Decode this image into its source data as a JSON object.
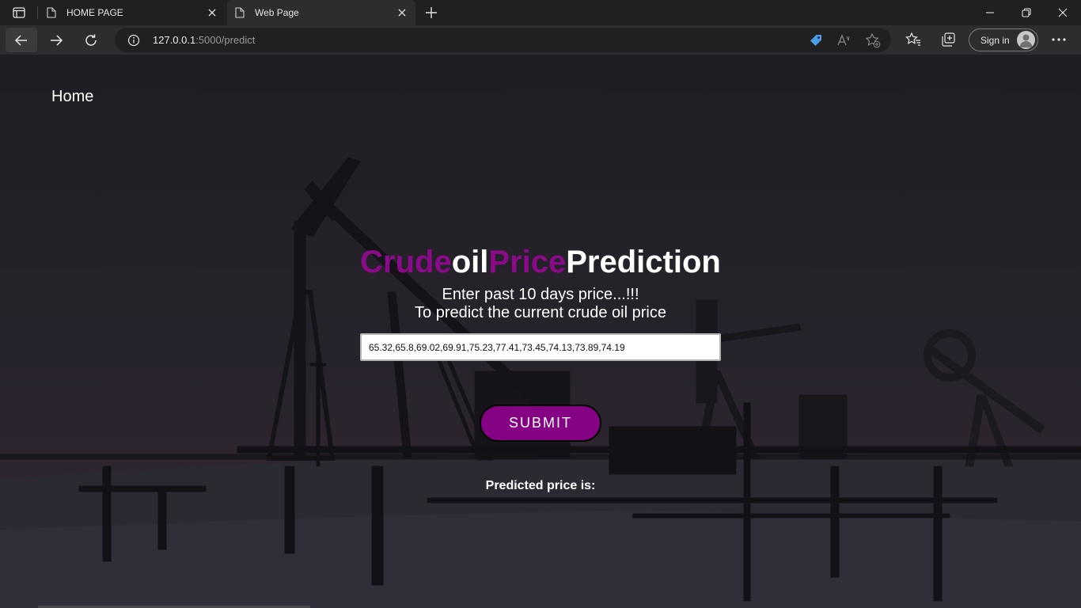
{
  "browser": {
    "tabs": [
      {
        "label": "HOME PAGE",
        "active": false
      },
      {
        "label": "Web Page",
        "active": true
      }
    ],
    "url_host": "127.0.0.1",
    "url_rest": ":5000/predict",
    "signin_label": "Sign in",
    "icons": {
      "tab_actions": "tab-actions-icon",
      "page": "page-icon",
      "close": "close-icon",
      "new_tab": "plus-icon",
      "back": "arrow-left-icon",
      "forward": "arrow-right-icon",
      "reload": "reload-icon",
      "info": "info-icon",
      "coupon": "tag-icon",
      "read_aloud": "read-aloud-icon",
      "add_favorite": "star-plus-icon",
      "favorites": "favorites-icon",
      "collections": "collections-icon",
      "more": "more-icon"
    }
  },
  "page": {
    "nav_home": "Home",
    "heading_parts": [
      "Crude",
      "oil",
      "Price",
      "Prediction"
    ],
    "subtitle_line1": "Enter past 10 days price...!!!",
    "subtitle_line2": "To predict the current crude oil price",
    "input_value": "65.32,65.8,69.02,69.91,75.23,77.41,73.45,74.13,73.89,74.19",
    "submit_label": "SUBMIT",
    "result_label": "Predicted price is:"
  },
  "colors": {
    "accent_purple": "#8a0a8a",
    "button_purple": "#850285",
    "browser_frame": "#202020",
    "toolbar": "#2d2d2d"
  }
}
